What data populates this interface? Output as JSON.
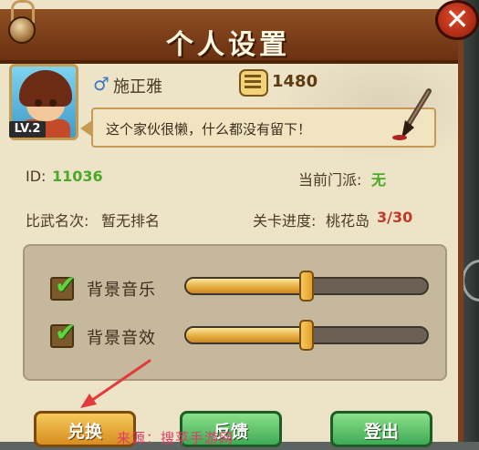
{
  "dialog": {
    "title": "个人设置",
    "close_label": "✕"
  },
  "profile": {
    "level": "LV.2",
    "gender_symbol": "♂",
    "name": "施正雅",
    "power": "1480",
    "signature": "这个家伙很懒，什么都没有留下！"
  },
  "info": {
    "id_label": "ID:",
    "id_value": "11036",
    "sect_label": "当前门派:",
    "sect_value": "无",
    "rank_label": "比武名次:",
    "rank_value": "暂无排名",
    "stage_label": "关卡进度:",
    "stage_name": "桃花岛",
    "stage_progress": "3/30"
  },
  "settings": {
    "music_label": "背景音乐",
    "music_enabled": true,
    "music_volume": 0.5,
    "sfx_label": "背景音效",
    "sfx_enabled": true,
    "sfx_volume": 0.5
  },
  "buttons": {
    "redeem": "兑换",
    "feedback": "反馈",
    "logout": "登出"
  },
  "overlay": {
    "caption": "来源：搜苹手游网"
  },
  "colors": {
    "accent_green": "#4aa928",
    "progress_red": "#c0392b",
    "annotation_red": "#e23b3b"
  }
}
